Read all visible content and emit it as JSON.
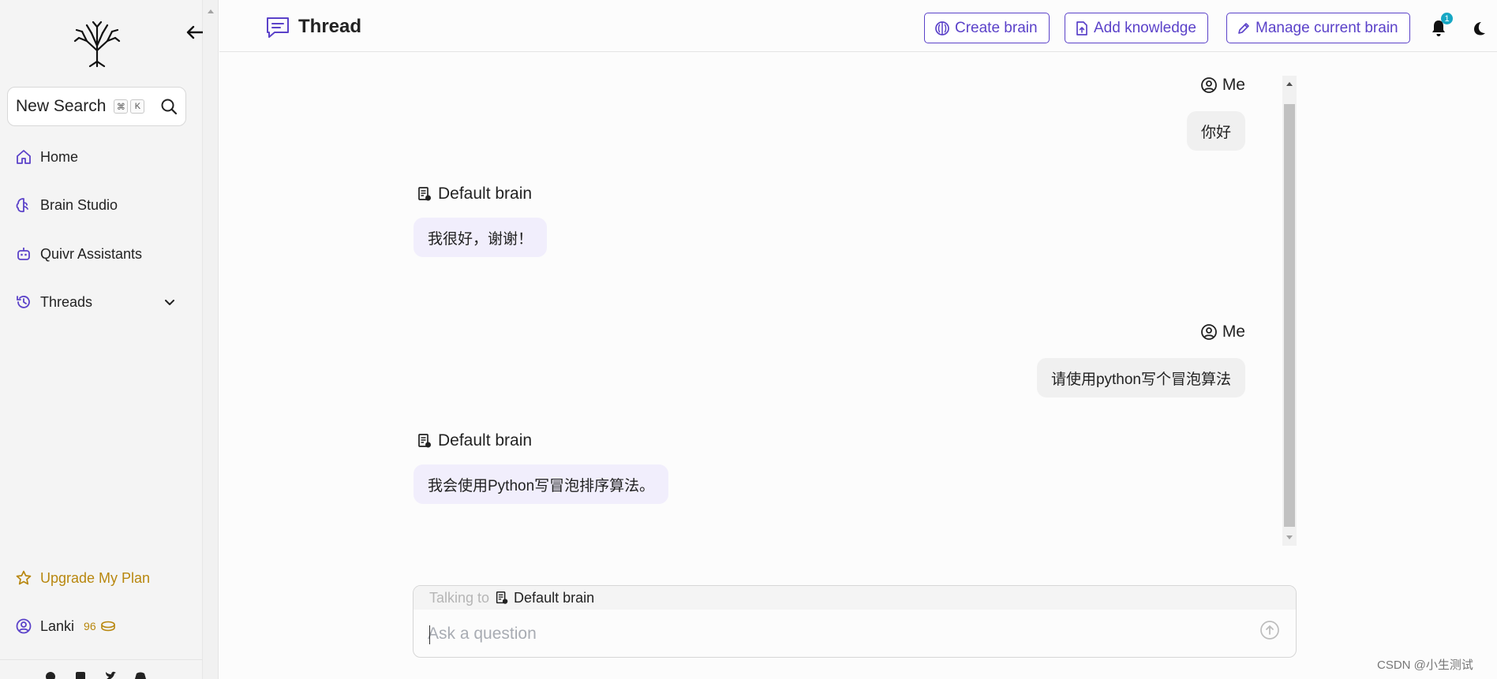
{
  "sidebar": {
    "search": {
      "label": "New Search",
      "keys": [
        "⌘",
        "K"
      ]
    },
    "nav": [
      {
        "label": "Home",
        "icon": "home-icon"
      },
      {
        "label": "Brain Studio",
        "icon": "brain-icon"
      },
      {
        "label": "Quivr Assistants",
        "icon": "robot-icon"
      },
      {
        "label": "Threads",
        "icon": "history-icon"
      }
    ],
    "upgrade": {
      "label": "Upgrade My Plan",
      "icon": "star-icon"
    },
    "user": {
      "name": "Lanki",
      "credits": "96",
      "icon": "user-circle-icon"
    }
  },
  "header": {
    "title": "Thread",
    "buttons": {
      "create_brain": "Create brain",
      "add_knowledge": "Add knowledge",
      "manage_brain": "Manage current brain"
    },
    "notification_count": "1"
  },
  "messages": [
    {
      "role": "user",
      "sender": "Me",
      "text": "你好"
    },
    {
      "role": "assistant",
      "sender": "Default brain",
      "text": "我很好，谢谢！"
    },
    {
      "role": "user",
      "sender": "Me",
      "text": "请使用python写个冒泡算法"
    },
    {
      "role": "assistant",
      "sender": "Default brain",
      "text": "我会使用Python写冒泡排序算法。"
    }
  ],
  "composer": {
    "talking_to_label": "Talking to",
    "brain_name": "Default brain",
    "placeholder": "Ask a question"
  },
  "watermark": "CSDN @小生测试",
  "colors": {
    "accent": "#5b42c9",
    "upgrade": "#b8870e",
    "badge": "#16a7c4",
    "assistant_bubble": "#f1eefc",
    "user_bubble": "#f0f0f0"
  }
}
